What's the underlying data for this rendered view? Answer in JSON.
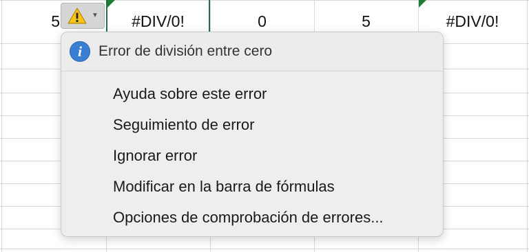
{
  "sheet": {
    "cells": [
      {
        "value": "5",
        "name": "cell-value-5-left"
      },
      {
        "value": "#DIV/0!",
        "name": "cell-div-error-selected"
      },
      {
        "value": "0",
        "name": "cell-value-0"
      },
      {
        "value": "5",
        "name": "cell-value-5"
      },
      {
        "value": "#DIV/0!",
        "name": "cell-div-error-right"
      }
    ]
  },
  "smart_tag": {
    "icon": "warning-triangle-icon",
    "dropdown_icon": "chevron-down-icon",
    "icon_color": "#f5c518"
  },
  "menu": {
    "header_icon": "info-icon",
    "header_icon_color": "#3b7fd3",
    "title": "Error de división entre cero",
    "items": [
      {
        "label": "Ayuda sobre este error"
      },
      {
        "label": "Seguimiento de error"
      },
      {
        "label": "Ignorar error"
      },
      {
        "label": "Modificar en la barra de fórmulas"
      },
      {
        "label": "Opciones de comprobación de errores..."
      }
    ]
  },
  "colors": {
    "selection_border": "#217346",
    "error_flag": "#1e7e34",
    "gridline": "#d9d9d9"
  }
}
